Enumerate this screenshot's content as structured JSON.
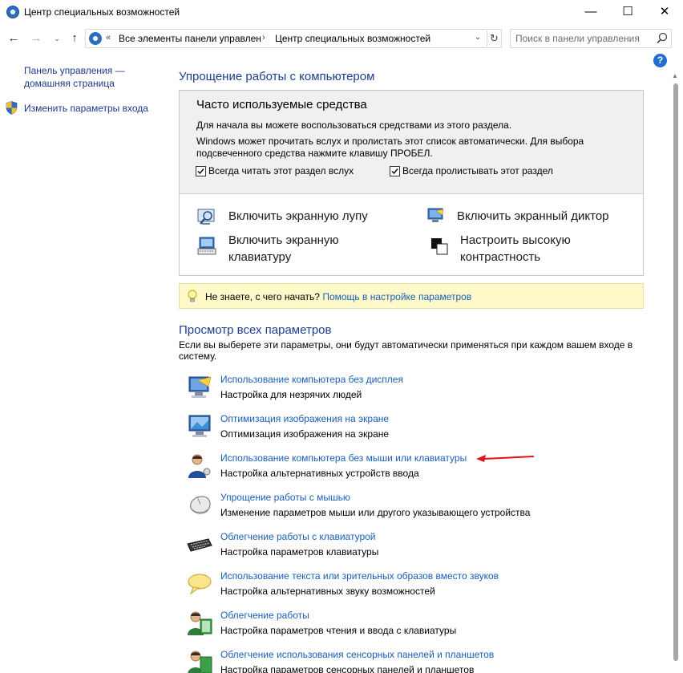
{
  "window": {
    "title": "Центр специальных возможностей",
    "minimize": "—",
    "maximize": "☐",
    "close": "✕"
  },
  "nav": {
    "back": "←",
    "forward": "→",
    "recent": "⌄",
    "up": "↑",
    "address_chevrons": "«",
    "breadcrumb_1": "Все элементы панели управлен",
    "breadcrumb_sep": "›",
    "breadcrumb_2": "Центр специальных возможностей",
    "dropdown": "⌄",
    "refresh": "↻",
    "search_placeholder": "Поиск в панели управления"
  },
  "left": {
    "home": "Панель управления — домашняя страница",
    "signin": "Изменить параметры входа"
  },
  "help": "?",
  "section1": {
    "title": "Упрощение работы с компьютером",
    "tools_heading": "Часто используемые средства",
    "p1": "Для начала вы можете воспользоваться средствами из этого раздела.",
    "p2": "Windows может прочитать вслух и пролистать этот список автоматически. Для выбора подсвеченного средства нажмите клавишу ПРОБЕЛ.",
    "checkbox_read": {
      "label": "Всегда читать этот раздел вслух",
      "checked": true
    },
    "checkbox_scan": {
      "label": "Всегда пролистывать этот раздел",
      "checked": true
    },
    "tools": [
      {
        "label": "Включить экранную лупу",
        "icon": "magnifier-icon"
      },
      {
        "label": "Включить экранный диктор",
        "icon": "narrator-icon"
      },
      {
        "label": "Включить экранную клавиатуру",
        "icon": "on-screen-keyboard-icon"
      },
      {
        "label": "Настроить высокую контрастность",
        "icon": "high-contrast-icon"
      }
    ]
  },
  "tip": {
    "text": "Не знаете, с чего начать?",
    "link": "Помощь в настройке параметров"
  },
  "section2": {
    "title": "Просмотр всех параметров",
    "desc": "Если вы выберете эти параметры, они будут автоматически применяться при каждом вашем входе в систему.",
    "items": [
      {
        "link": "Использование компьютера без дисплея",
        "desc": "Настройка для незрячих людей",
        "icon": "monitor-speech-icon"
      },
      {
        "link": "Оптимизация изображения на экране",
        "desc": "Оптимизация изображения на экране",
        "icon": "monitor-display-icon"
      },
      {
        "link": "Использование компьютера без мыши или клавиатуры",
        "desc": "Настройка альтернативных устройств ввода",
        "icon": "user-input-icon"
      },
      {
        "link": "Упрощение работы с мышью",
        "desc": "Изменение параметров мыши или другого указывающего устройства",
        "icon": "mouse-icon"
      },
      {
        "link": "Облегчение работы с клавиатурой",
        "desc": "Настройка параметров клавиатуры",
        "icon": "keyboard-icon"
      },
      {
        "link": "Использование текста или зрительных образов вместо звуков",
        "desc": "Настройка альтернативных звуку возможностей",
        "icon": "speech-bubble-icon"
      },
      {
        "link": "Облегчение работы",
        "desc": "Настройка параметров чтения и ввода с клавиатуры",
        "icon": "user-book-icon"
      },
      {
        "link": "Облегчение использования сенсорных панелей и планшетов",
        "desc": "Настройка параметров сенсорных панелей и планшетов",
        "icon": "user-tablet-icon"
      }
    ]
  },
  "colors": {
    "link": "#1a5eb8",
    "heading": "#1e3d8f",
    "tip_bg": "#fdf9c9",
    "tools_bg": "#f0f0f0",
    "annotation_arrow": "#e0121a"
  }
}
